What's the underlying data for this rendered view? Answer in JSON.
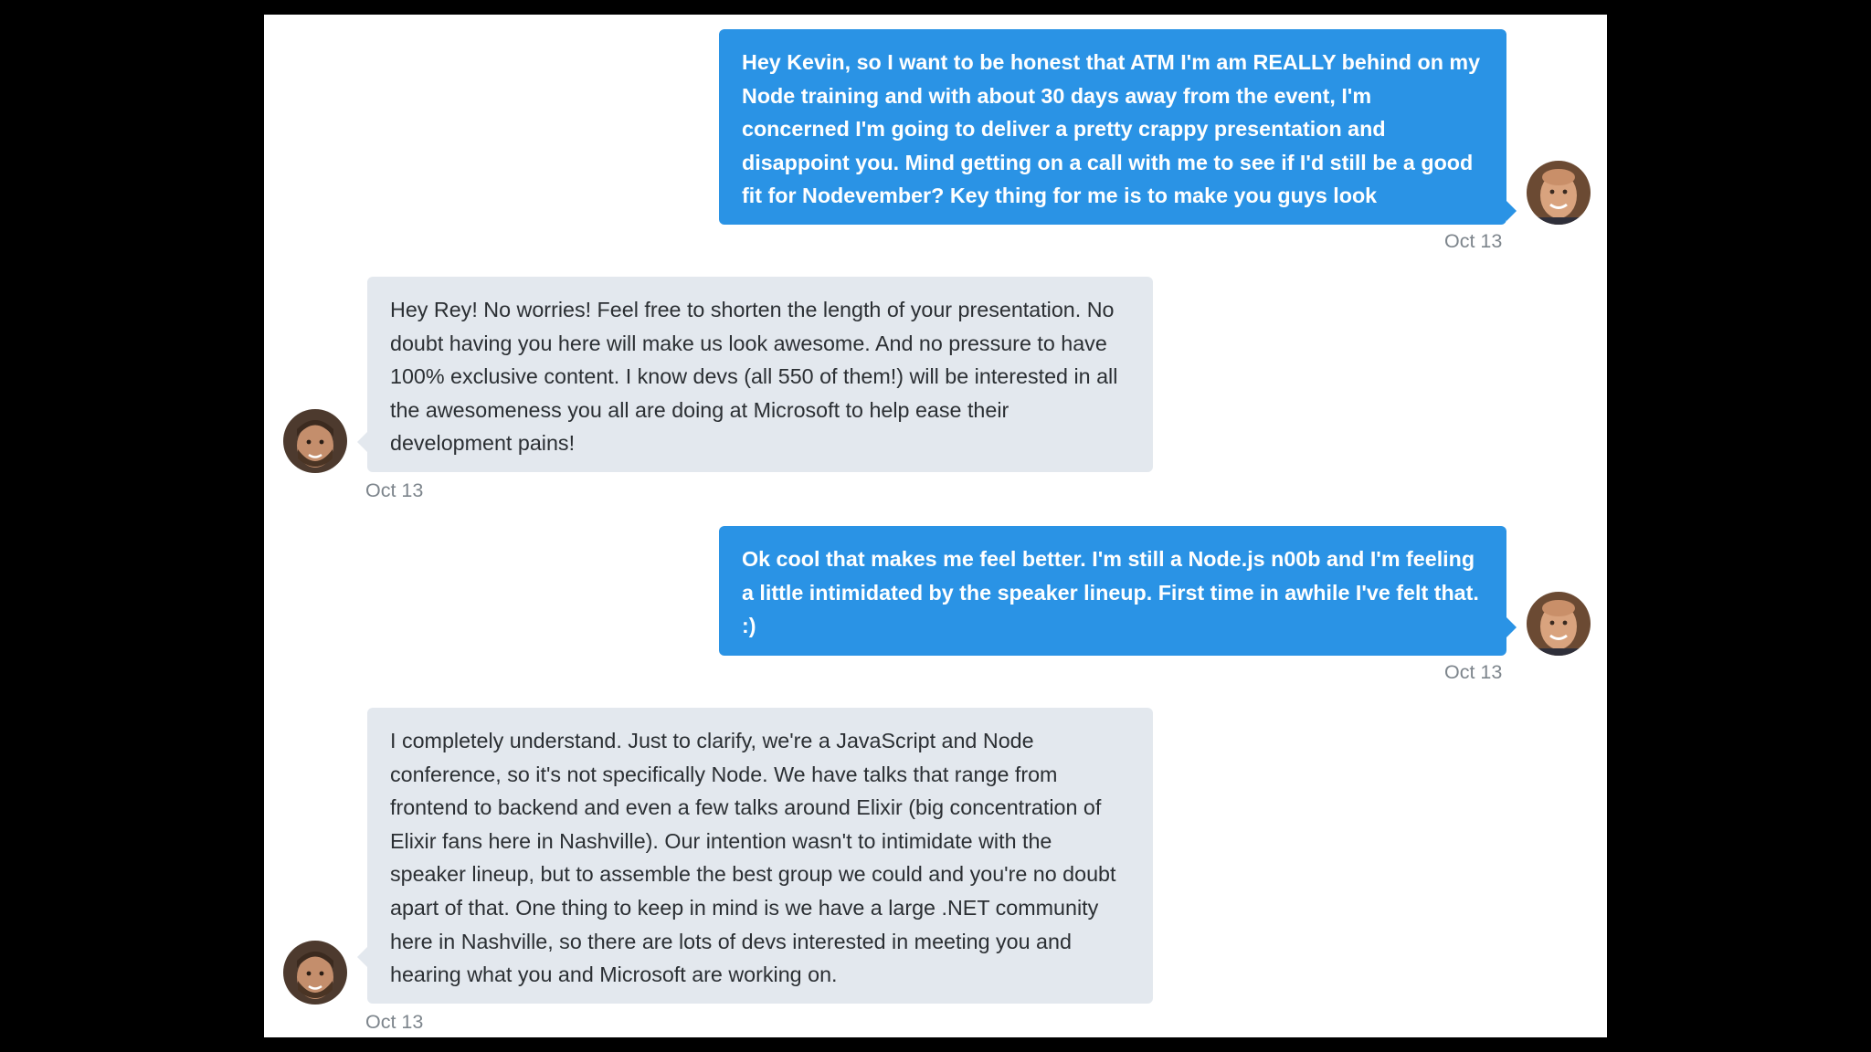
{
  "conversation": {
    "messages": [
      {
        "sender": "me",
        "text": "Hey Kevin, so I want to be honest that ATM I'm am REALLY behind on my Node training and with about 30 days away from the event, I'm concerned I'm going to deliver a pretty crappy presentation and disappoint you. Mind getting on a call with me to see if I'd still be a good fit for Nodevember? Key thing for me is to make you guys look awesome.",
        "date": "Oct 13"
      },
      {
        "sender": "them",
        "text": "Hey Rey!  No worries!  Feel free to shorten the length of your presentation.  No doubt having you here will make us look awesome.  And no pressure to have 100% exclusive content.  I know devs (all 550 of them!) will be interested in all the awesomeness you all are doing at Microsoft to help ease their development pains!",
        "date": "Oct 13"
      },
      {
        "sender": "me",
        "text": "Ok cool that makes me feel better. I'm still a Node.js n00b and I'm feeling a little intimidated by the speaker lineup. First time in awhile I've felt that. :)",
        "date": "Oct 13"
      },
      {
        "sender": "them",
        "text": "I completely understand.  Just to clarify, we're a JavaScript and Node conference, so it's not specifically Node.  We have talks that range from frontend to backend and even a few talks around Elixir (big concentration of Elixir fans here in Nashville).  Our intention wasn't to intimidate with the speaker lineup, but to assemble the best group we could and you're no doubt apart of that.  One thing to keep in mind is we have a large .NET community here in Nashville, so there are lots of devs interested in meeting you and hearing what you and Microsoft are working on.",
        "date": "Oct 13"
      }
    ]
  },
  "colors": {
    "outgoing_bubble": "#2a93e5",
    "incoming_bubble": "#e3e8ee",
    "timestamp": "#7d858c",
    "background": "#000000",
    "panel": "#ffffff"
  },
  "icons": {
    "my_avatar": "avatar-bald-man-icon",
    "their_avatar": "avatar-bearded-man-icon"
  }
}
